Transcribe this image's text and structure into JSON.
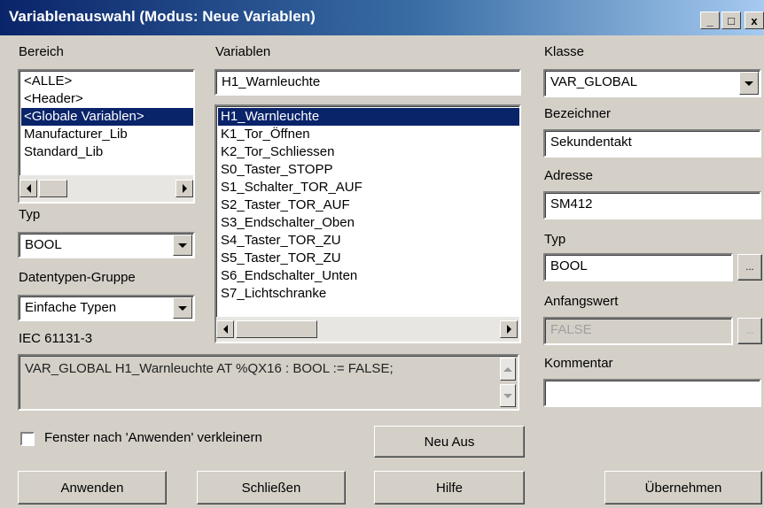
{
  "window": {
    "title": "Variablenauswahl (Modus: Neue Variablen)",
    "min_icon": "_",
    "max_icon": "□",
    "close_icon": "x"
  },
  "bereich": {
    "label": "Bereich",
    "items": [
      "<ALLE>",
      "<Header>",
      "<Globale Variablen>",
      "Manufacturer_Lib",
      "Standard_Lib"
    ],
    "selected_index": 2
  },
  "typ_left": {
    "label": "Typ",
    "value": "BOOL"
  },
  "datentypen": {
    "label": "Datentypen-Gruppe",
    "value": "Einfache Typen"
  },
  "iec": {
    "label": "IEC 61131-3",
    "text": "VAR_GLOBAL H1_Warnleuchte AT %QX16 : BOOL := FALSE;"
  },
  "variablen": {
    "label": "Variablen",
    "filter_value": "H1_Warnleuchte",
    "items": [
      "H1_Warnleuchte",
      "K1_Tor_Öffnen",
      "K2_Tor_Schliessen",
      "S0_Taster_STOPP",
      "S1_Schalter_TOR_AUF",
      "S2_Taster_TOR_AUF",
      "S3_Endschalter_Oben",
      "S4_Taster_TOR_ZU",
      "S5_Taster_TOR_ZU",
      "S6_Endschalter_Unten",
      "S7_Lichtschranke"
    ],
    "selected_index": 0
  },
  "klasse": {
    "label": "Klasse",
    "value": "VAR_GLOBAL"
  },
  "bezeichner": {
    "label": "Bezeichner",
    "value": "Sekundentakt"
  },
  "adresse": {
    "label": "Adresse",
    "value": "SM412"
  },
  "typ_right": {
    "label": "Typ",
    "browse_label": "...",
    "value": "BOOL"
  },
  "anfangswert": {
    "label": "Anfangswert",
    "value": "FALSE",
    "browse_label": "..."
  },
  "kommentar": {
    "label": "Kommentar",
    "value": ""
  },
  "checkbox": {
    "label": "Fenster nach 'Anwenden' verkleinern",
    "checked": false
  },
  "buttons": {
    "neu_aus": "Neu Aus",
    "anwenden": "Anwenden",
    "schliessen": "Schließen",
    "hilfe": "Hilfe",
    "uebernehmen": "Übernehmen"
  },
  "colors": {
    "titlebar": "#0a246a",
    "selection": "#0a246a",
    "face": "#d4d0c8"
  }
}
